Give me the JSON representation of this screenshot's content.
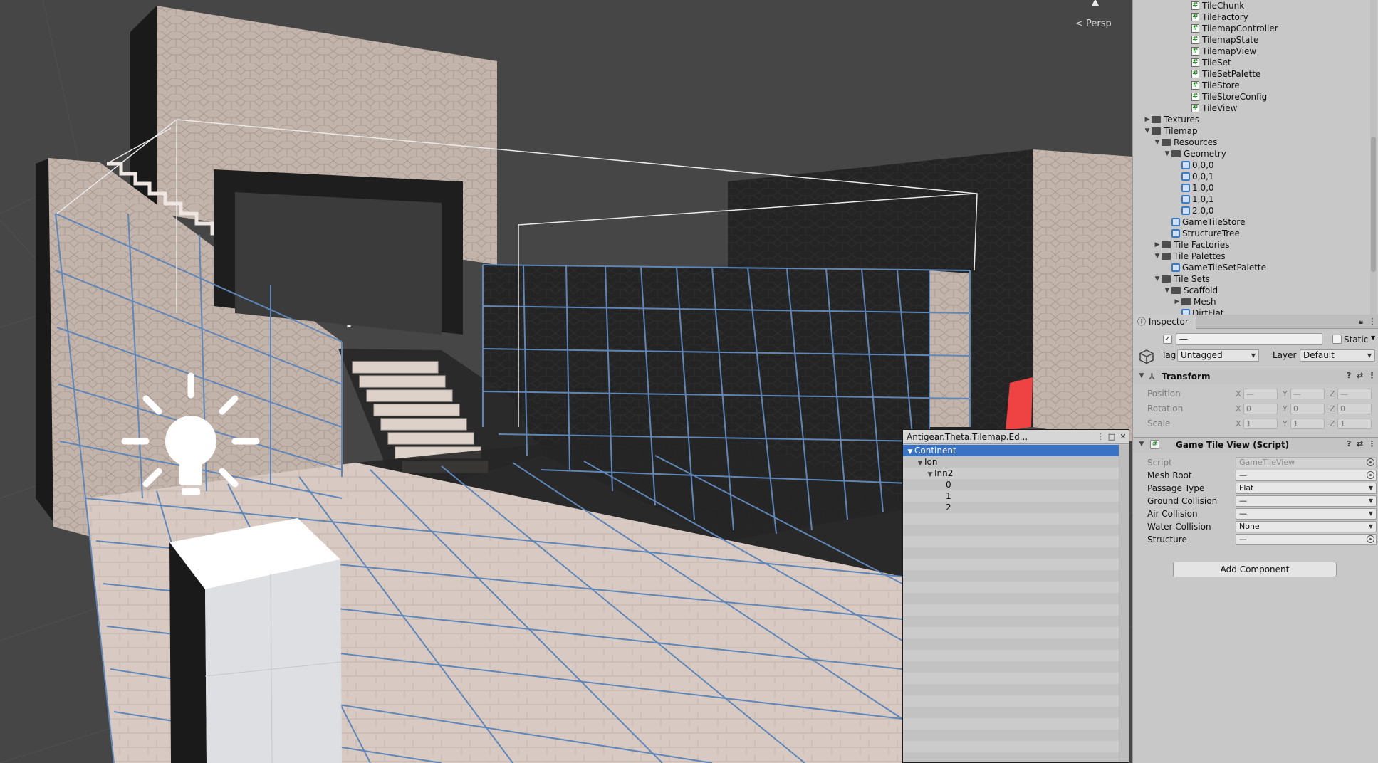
{
  "scene": {
    "projection_label": "< Persp"
  },
  "tree_window": {
    "title": "Antigear.Theta.Tilemap.Ed...",
    "rows": [
      {
        "label": "Continent",
        "depth": 0,
        "expanded": true,
        "selected": true
      },
      {
        "label": "Ion",
        "depth": 1,
        "expanded": true,
        "selected": false
      },
      {
        "label": "Inn2",
        "depth": 2,
        "expanded": true,
        "selected": false
      },
      {
        "label": "0",
        "depth": 3,
        "expanded": null,
        "selected": false
      },
      {
        "label": "1",
        "depth": 3,
        "expanded": null,
        "selected": false
      },
      {
        "label": "2",
        "depth": 3,
        "expanded": null,
        "selected": false
      }
    ]
  },
  "project": {
    "rows": [
      {
        "label": "TileChunk",
        "icon": "script",
        "depth": 5,
        "arrow": ""
      },
      {
        "label": "TileFactory",
        "icon": "script",
        "depth": 5,
        "arrow": ""
      },
      {
        "label": "TilemapController",
        "icon": "script",
        "depth": 5,
        "arrow": ""
      },
      {
        "label": "TilemapState",
        "icon": "script",
        "depth": 5,
        "arrow": ""
      },
      {
        "label": "TilemapView",
        "icon": "script",
        "depth": 5,
        "arrow": ""
      },
      {
        "label": "TileSet",
        "icon": "script",
        "depth": 5,
        "arrow": ""
      },
      {
        "label": "TileSetPalette",
        "icon": "script",
        "depth": 5,
        "arrow": ""
      },
      {
        "label": "TileStore",
        "icon": "script",
        "depth": 5,
        "arrow": ""
      },
      {
        "label": "TileStoreConfig",
        "icon": "script",
        "depth": 5,
        "arrow": ""
      },
      {
        "label": "TileView",
        "icon": "script",
        "depth": 5,
        "arrow": ""
      },
      {
        "label": "Textures",
        "icon": "folder",
        "depth": 1,
        "arrow": "▶"
      },
      {
        "label": "Tilemap",
        "icon": "folder",
        "depth": 1,
        "arrow": "▼"
      },
      {
        "label": "Resources",
        "icon": "folder",
        "depth": 2,
        "arrow": "▼"
      },
      {
        "label": "Geometry",
        "icon": "folder",
        "depth": 3,
        "arrow": "▼"
      },
      {
        "label": "0,0,0",
        "icon": "prefab",
        "depth": 4,
        "arrow": ""
      },
      {
        "label": "0,0,1",
        "icon": "prefab",
        "depth": 4,
        "arrow": ""
      },
      {
        "label": "1,0,0",
        "icon": "prefab",
        "depth": 4,
        "arrow": ""
      },
      {
        "label": "1,0,1",
        "icon": "prefab",
        "depth": 4,
        "arrow": ""
      },
      {
        "label": "2,0,0",
        "icon": "prefab",
        "depth": 4,
        "arrow": ""
      },
      {
        "label": "GameTileStore",
        "icon": "prefab",
        "depth": 3,
        "arrow": ""
      },
      {
        "label": "StructureTree",
        "icon": "prefab",
        "depth": 3,
        "arrow": ""
      },
      {
        "label": "Tile Factories",
        "icon": "folder",
        "depth": 2,
        "arrow": "▶"
      },
      {
        "label": "Tile Palettes",
        "icon": "folder",
        "depth": 2,
        "arrow": "▼"
      },
      {
        "label": "GameTileSetPalette",
        "icon": "prefab",
        "depth": 3,
        "arrow": ""
      },
      {
        "label": "Tile Sets",
        "icon": "folder",
        "depth": 2,
        "arrow": "▼"
      },
      {
        "label": "Scaffold",
        "icon": "folder",
        "depth": 3,
        "arrow": "▼"
      },
      {
        "label": "Mesh",
        "icon": "folder",
        "depth": 4,
        "arrow": "▶"
      },
      {
        "label": "DirtFlat",
        "icon": "prefab",
        "depth": 4,
        "arrow": ""
      }
    ]
  },
  "inspector": {
    "tab_label": "Inspector",
    "object_name": "—",
    "static_label": "Static",
    "tag_label": "Tag",
    "tag_value": "Untagged",
    "layer_label": "Layer",
    "layer_value": "Default",
    "transform": {
      "title": "Transform",
      "position_label": "Position",
      "rotation_label": "Rotation",
      "scale_label": "Scale",
      "position": [
        "—",
        "—",
        "—"
      ],
      "rotation": [
        "0",
        "0",
        "0"
      ],
      "scale": [
        "1",
        "1",
        "1"
      ],
      "axes": [
        "X",
        "Y",
        "Z"
      ]
    },
    "component": {
      "title": "Game Tile View (Script)",
      "fields": [
        {
          "label": "Script",
          "value": "GameTileView",
          "kind": "object",
          "dim": true
        },
        {
          "label": "Mesh Root",
          "value": "—",
          "kind": "object",
          "dim": false
        },
        {
          "label": "Passage Type",
          "value": "Flat",
          "kind": "dropdown",
          "dim": false
        },
        {
          "label": "Ground Collision",
          "value": "—",
          "kind": "dropdown",
          "dim": false
        },
        {
          "label": "Air Collision",
          "value": "—",
          "kind": "dropdown",
          "dim": false
        },
        {
          "label": "Water Collision",
          "value": "None",
          "kind": "dropdown",
          "dim": false
        },
        {
          "label": "Structure",
          "value": "—",
          "kind": "object",
          "dim": false
        }
      ]
    },
    "add_component_label": "Add Component"
  }
}
